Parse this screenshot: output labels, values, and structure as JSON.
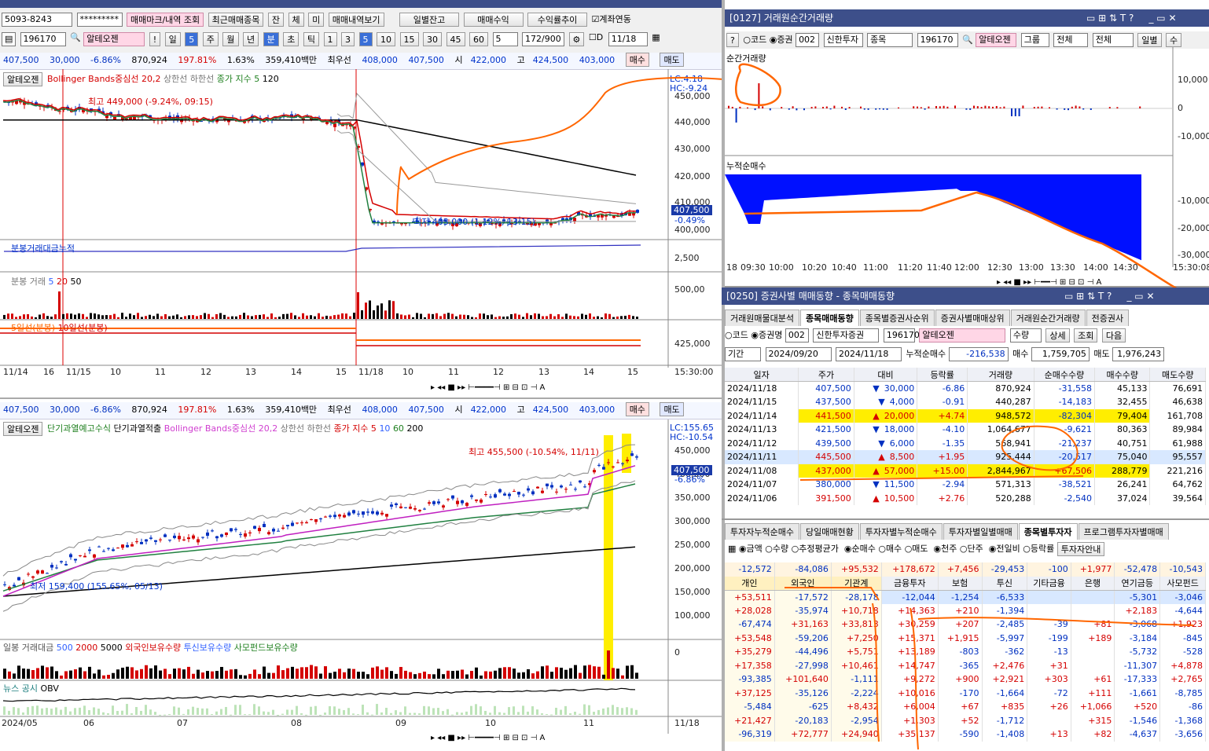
{
  "left_top": {
    "account": "5093-8243",
    "password": "*********",
    "buttons": [
      "매매마크/내역 조회",
      "최근매매종목",
      "잔",
      "체",
      "미",
      "매매내역보기",
      "일별잔고",
      "매매수익",
      "수익률추이"
    ],
    "checkbox_label": "계좌연동",
    "code": "196170",
    "stock_name": "알테오젠",
    "period_buttons": [
      "일",
      "5",
      "주",
      "월",
      "년",
      "분",
      "초",
      "틱",
      "1",
      "3",
      "5",
      "10",
      "15",
      "30",
      "45",
      "60",
      "5"
    ],
    "count": "172/900",
    "date": "11/18",
    "d_label": "D"
  },
  "quote": {
    "price": "407,500",
    "change": "30,000",
    "pct": "-6.86%",
    "volume": "870,924",
    "vol_ratio": "197.81%",
    "turnover": "1.63%",
    "amount": "359,410백만",
    "best_label": "최우선",
    "ask": "408,000",
    "bid": "407,500",
    "open_label": "시",
    "open": "422,000",
    "high_label": "고",
    "high": "424,500",
    "low": "403,000",
    "buy": "매수",
    "sell": "매도"
  },
  "chart1": {
    "legend": [
      "알테오젠",
      "Bollinger Bands중심선 20,2",
      "상한선",
      "하한선",
      "종가 지수 5",
      "120"
    ],
    "lc": "LC:4.18",
    "hc": "HC:-9.24",
    "max_label": "최고 449,000 (-9.24%, 09:15)",
    "min_label": "최저 403,000 (1.12%, 13:15)",
    "yticks": [
      "450,000",
      "440,000",
      "430,000",
      "420,000",
      "410,000",
      "400,000"
    ],
    "price_tag": "407,500",
    "price_pct": "-0.49%",
    "sub1_title": "분봉거래대금누적",
    "sub1_tick": "2,500",
    "sub2_title": "분봉 거래",
    "sub2_legend": [
      "5",
      "20",
      "50"
    ],
    "sub2_tick": "500,00",
    "sub3_title": "5일선(분봉)",
    "sub3_title2": "10일선(분봉)",
    "sub3_tick": "425,000",
    "xticks": [
      "11/14",
      "16",
      "11/15",
      "10",
      "11",
      "12",
      "13",
      "14",
      "15",
      "11/18",
      "10",
      "11",
      "12",
      "13",
      "14",
      "15",
      "15:30:00"
    ]
  },
  "chart2": {
    "legend": [
      "알테오젠",
      "단기과열예고수식",
      "단기과열적출",
      "Bollinger Bands중심선 20,2",
      "상한선",
      "하한선",
      "종가 지수 5",
      "10",
      "60",
      "200"
    ],
    "lc": "LC:155.65",
    "hc": "HC:-10.54",
    "max_label": "최고 455,500 (-10.54%, 11/11)",
    "min_label": "최저 159,400 (155.65%, 05/13)",
    "yticks": [
      "450,000",
      "400,000",
      "350,000",
      "300,000",
      "250,000",
      "200,000",
      "150,000",
      "100,000"
    ],
    "price_tag": "407,500",
    "price_pct": "-6.86%",
    "sub1_legend": [
      "일봉 거래대금",
      "500",
      "2000",
      "5000",
      "외국인보유수량",
      "투신보유수량",
      "사모펀드보유수량"
    ],
    "sub1_tick": "0",
    "sub2_legend": [
      "뉴스",
      "공시",
      "OBV"
    ],
    "xticks": [
      "2024/05",
      "06",
      "07",
      "08",
      "09",
      "10",
      "11",
      "11/18"
    ]
  },
  "right_top": {
    "title": "[0127] 거래원순간거래량",
    "radio": [
      "코드",
      "증권"
    ],
    "broker_code": "002",
    "broker": "신한투자",
    "type": "종목",
    "code": "196170",
    "stock": "알테오젠",
    "group": "그룹",
    "all": "전체",
    "all2": "전체",
    "daily": "일별",
    "su": "수",
    "chart_title": "순간거래량",
    "yticks1": [
      "10,000",
      "0",
      "-10,000"
    ],
    "chart2_title": "누적순매수",
    "yticks2": [
      "-10,000",
      "-20,000",
      "-30,000"
    ],
    "xticks": [
      "18",
      "09:30",
      "10:00",
      "10:20",
      "10:40",
      "11:00",
      "11:20",
      "11:40",
      "12:00",
      "12:30",
      "13:00",
      "13:30",
      "14:00",
      "14:30",
      "15:30:08"
    ]
  },
  "right_mid": {
    "title": "[0250] 증권사별 매매동향 - 종목매매동향",
    "tabs": [
      "거래원매물대분석",
      "종목매매동향",
      "종목별증권사순위",
      "증권사별매매상위",
      "거래원순간거래량",
      "전증권사"
    ],
    "radio": [
      "코드",
      "증권명"
    ],
    "broker_code": "002",
    "broker": "신한투자증권",
    "code": "196170",
    "stock": "알테오젠",
    "unit": "수량",
    "detail": "상세",
    "query": "조회",
    "next": "다음",
    "period_label": "기간",
    "date_from": "2024/09/20",
    "date_to": "2024/11/18",
    "cum_label": "누적순매수",
    "cum_val": "-216,538",
    "buy_label": "매수",
    "buy_val": "1,759,705",
    "sell_label": "매도",
    "sell_val": "1,976,243",
    "headers": [
      "일자",
      "주가",
      "대비",
      "등락률",
      "거래량",
      "순매수수량",
      "매수수량",
      "매도수량"
    ],
    "rows": [
      [
        "2024/11/18",
        "407,500",
        "▼",
        "30,000",
        "-6.86",
        "870,924",
        "-31,558",
        "45,133",
        "76,691"
      ],
      [
        "2024/11/15",
        "437,500",
        "▼",
        "4,000",
        "-0.91",
        "440,287",
        "-14,183",
        "32,455",
        "46,638"
      ],
      [
        "2024/11/14",
        "441,500",
        "▲",
        "20,000",
        "+4.74",
        "948,572",
        "-82,304",
        "79,404",
        "161,708"
      ],
      [
        "2024/11/13",
        "421,500",
        "▼",
        "18,000",
        "-4.10",
        "1,064,677",
        "-9,621",
        "80,363",
        "89,984"
      ],
      [
        "2024/11/12",
        "439,500",
        "▼",
        "6,000",
        "-1.35",
        "568,941",
        "-21,237",
        "40,751",
        "61,988"
      ],
      [
        "2024/11/11",
        "445,500",
        "▲",
        "8,500",
        "+1.95",
        "925,444",
        "-20,517",
        "75,040",
        "95,557"
      ],
      [
        "2024/11/08",
        "437,000",
        "▲",
        "57,000",
        "+15.00",
        "2,844,967",
        "+67,506",
        "288,779",
        "221,216"
      ],
      [
        "2024/11/07",
        "380,000",
        "▼",
        "11,500",
        "-2.94",
        "571,313",
        "-38,521",
        "26,241",
        "64,762"
      ],
      [
        "2024/11/06",
        "391,500",
        "▲",
        "10,500",
        "+2.76",
        "520,288",
        "-2,540",
        "37,024",
        "39,564"
      ]
    ]
  },
  "right_bot": {
    "tabs": [
      "투자자누적순매수",
      "당일매매현황",
      "투자자별누적순매수",
      "투자자별일별매매",
      "종목별투자자",
      "프로그램투자자별매매"
    ],
    "options": [
      "금액",
      "수량",
      "추정평균가",
      "순매수",
      "매수",
      "매도",
      "천주",
      "단주",
      "전일비",
      "등락률"
    ],
    "info_btn": "투자자안내",
    "sum_row": [
      "-12,572",
      "-84,086",
      "+95,532",
      "+178,672",
      "+7,456",
      "-29,453",
      "-100",
      "+1,977",
      "-52,478",
      "-10,543"
    ],
    "headers": [
      "개인",
      "외국인",
      "기관계",
      "금융투자",
      "보험",
      "투신",
      "기타금융",
      "은행",
      "연기금등",
      "사모펀드"
    ],
    "rows": [
      [
        "+53,511",
        "-17,572",
        "-28,178",
        "-12,044",
        "-1,254",
        "-6,533",
        "",
        "",
        "-5,301",
        "-3,046"
      ],
      [
        "+28,028",
        "-35,974",
        "+10,718",
        "+14,363",
        "+210",
        "-1,394",
        "",
        "",
        "+2,183",
        "-4,644"
      ],
      [
        "-67,474",
        "+31,163",
        "+33,813",
        "+30,259",
        "+207",
        "-2,485",
        "-39",
        "+81",
        "-3,068",
        "+1,923"
      ],
      [
        "+53,548",
        "-59,206",
        "+7,250",
        "+15,371",
        "+1,915",
        "-5,997",
        "-199",
        "+189",
        "-3,184",
        "-845"
      ],
      [
        "+35,279",
        "-44,496",
        "+5,751",
        "+13,189",
        "-803",
        "-362",
        "-13",
        "",
        "-5,732",
        "-528"
      ],
      [
        "+17,358",
        "-27,998",
        "+10,461",
        "+14,747",
        "-365",
        "+2,476",
        "+31",
        "",
        "-11,307",
        "+4,878"
      ],
      [
        "-93,385",
        "+101,640",
        "-1,111",
        "+9,272",
        "+900",
        "+2,921",
        "+303",
        "+61",
        "-17,333",
        "+2,765"
      ],
      [
        "+37,125",
        "-35,126",
        "-2,224",
        "+10,016",
        "-170",
        "-1,664",
        "-72",
        "+111",
        "-1,661",
        "-8,785"
      ],
      [
        "-5,484",
        "-625",
        "+8,432",
        "+6,004",
        "+67",
        "+835",
        "+26",
        "+1,066",
        "+520",
        "-86"
      ],
      [
        "+21,427",
        "-20,183",
        "-2,954",
        "+1,303",
        "+52",
        "-1,712",
        "",
        "+315",
        "-1,546",
        "-1,368"
      ],
      [
        "-96,319",
        "+72,777",
        "+24,940",
        "+35,137",
        "-590",
        "-1,408",
        "+13",
        "+82",
        "-4,637",
        "-3,656"
      ]
    ]
  },
  "colors": {
    "up": "#d40000",
    "down": "#0030c0",
    "annot": "#ff6600",
    "hl": "#ffee00"
  }
}
